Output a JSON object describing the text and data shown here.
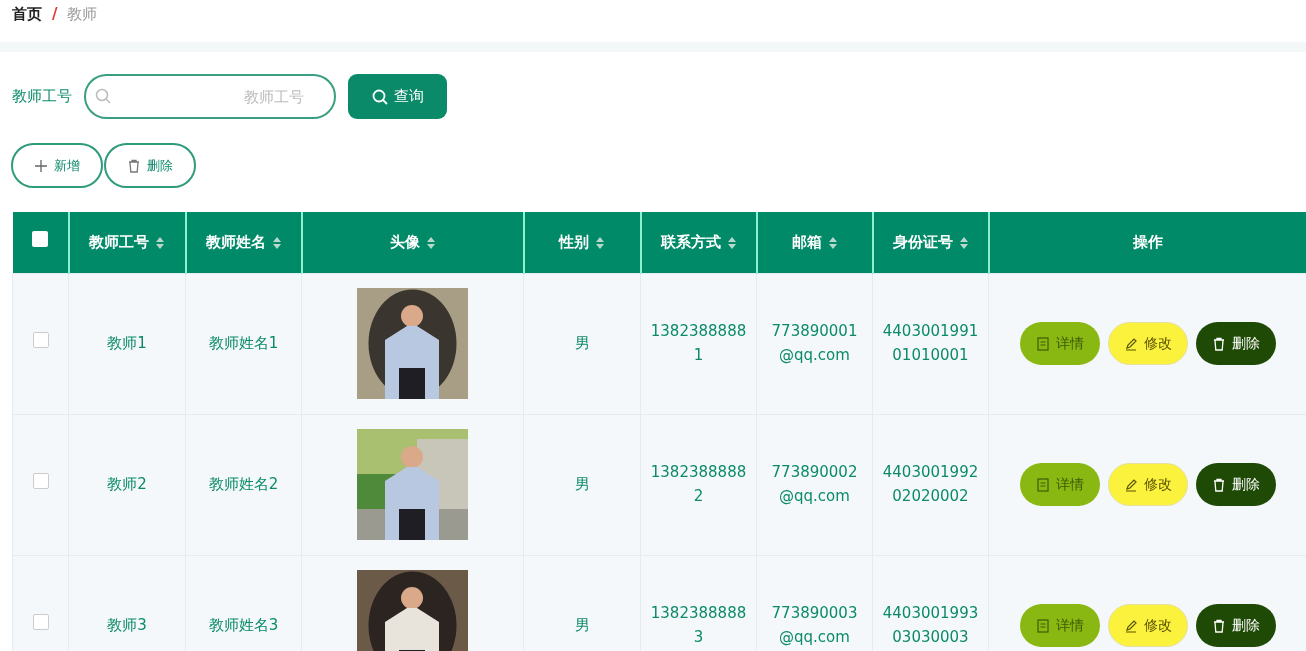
{
  "breadcrumb_separator": "/",
  "breadcrumb": [
    {
      "label": "首页",
      "current": false
    },
    {
      "label": "教师",
      "current": true
    }
  ],
  "search": {
    "label": "教师工号",
    "placeholder": "教师工号",
    "button": "查询"
  },
  "actions": [
    {
      "kind": "add",
      "label": "新增"
    },
    {
      "kind": "delete",
      "label": "删除"
    }
  ],
  "table": {
    "select_all": {
      "checked": false
    },
    "columns": [
      {
        "label": "教师工号",
        "sortable": true
      },
      {
        "label": "教师姓名",
        "sortable": true
      },
      {
        "label": "头像",
        "sortable": true
      },
      {
        "label": "性别",
        "sortable": true
      },
      {
        "label": "联系方式",
        "sortable": true
      },
      {
        "label": "邮箱",
        "sortable": true
      },
      {
        "label": "身份证号",
        "sortable": true
      },
      {
        "label": "操作",
        "sortable": false
      }
    ],
    "rows": [
      {
        "checked": false,
        "id": "教师1",
        "name": "教师姓名1",
        "gender": "男",
        "phone": "13823888881",
        "email": "773890001@qq.com",
        "id_card": "440300199101010001",
        "buttons": [
          {
            "kind": "detail",
            "label": "详情"
          },
          {
            "kind": "edit",
            "label": "修改"
          },
          {
            "kind": "delete",
            "label": "删除"
          }
        ]
      },
      {
        "checked": false,
        "id": "教师2",
        "name": "教师姓名2",
        "gender": "男",
        "phone": "13823888882",
        "email": "773890002@qq.com",
        "id_card": "440300199202020002",
        "buttons": [
          {
            "kind": "detail",
            "label": "详情"
          },
          {
            "kind": "edit",
            "label": "修改"
          },
          {
            "kind": "delete",
            "label": "删除"
          }
        ]
      },
      {
        "checked": false,
        "id": "教师3",
        "name": "教师姓名3",
        "gender": "男",
        "phone": "13823888883",
        "email": "773890003@qq.com",
        "id_card": "440300199303030003",
        "buttons": [
          {
            "kind": "detail",
            "label": "详情"
          },
          {
            "kind": "edit",
            "label": "修改"
          },
          {
            "kind": "delete",
            "label": "删除"
          }
        ]
      }
    ]
  }
}
